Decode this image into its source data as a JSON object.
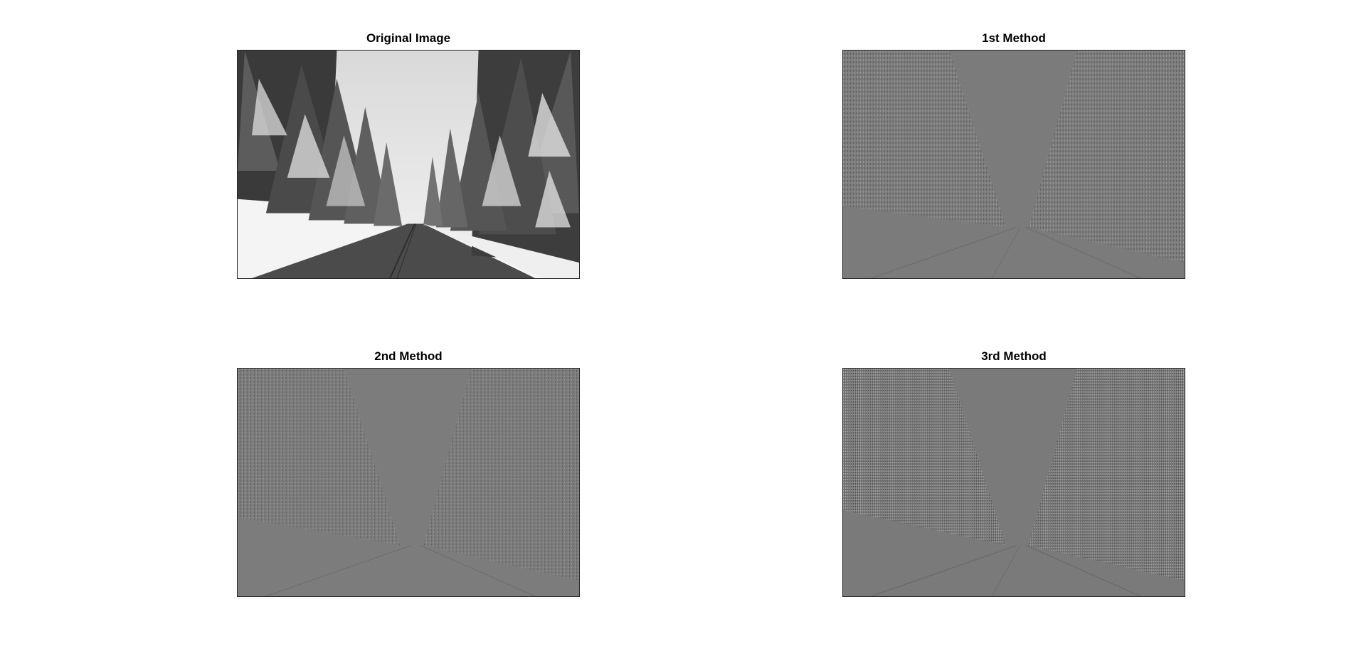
{
  "figure": {
    "panels": [
      {
        "title": "Original Image",
        "image": "snowy-road-forest-grayscale"
      },
      {
        "title": "1st Method",
        "image": "filtered-edge-response"
      },
      {
        "title": "2nd Method",
        "image": "filtered-edge-response"
      },
      {
        "title": "3rd Method",
        "image": "filtered-edge-response"
      }
    ]
  },
  "colors": {
    "background": "#ffffff",
    "filtered_gray": "#7a7a7a",
    "sky": "#e6e6e6",
    "road": "#4a4a4a"
  }
}
